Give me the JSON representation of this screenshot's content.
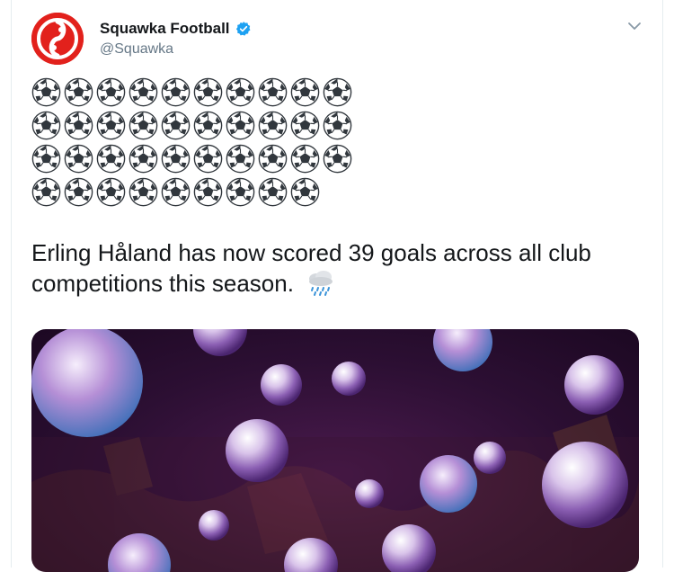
{
  "tweet": {
    "display_name": "Squawka Football",
    "handle": "@Squawka",
    "verified_icon": "verified-badge-icon",
    "menu_icon": "chevron-down-icon",
    "ball_emoji": "soccer-ball-icon",
    "ball_count": 39,
    "text": "Erling Håland has now scored 39 goals across all club competitions this season.",
    "text_emoji": "cloud-with-rain-icon",
    "media_description": "soccer-balls-over-crowd-image",
    "colors": {
      "brand_red": "#e2211c",
      "verified_blue": "#1da1f2",
      "handle_gray": "#657786",
      "media_purple": "#2c0f33"
    }
  }
}
